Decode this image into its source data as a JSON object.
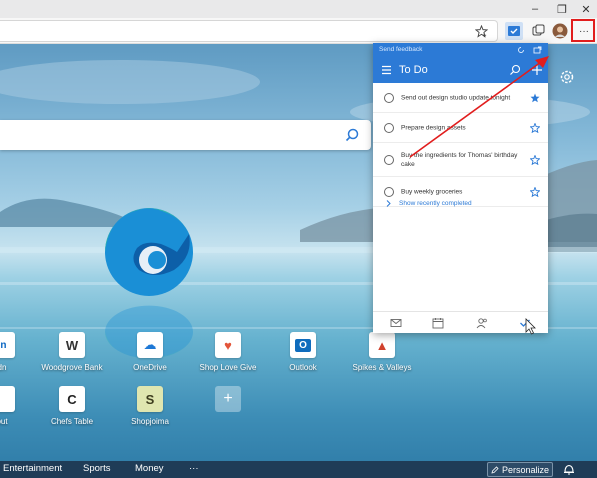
{
  "toolbar": {
    "favorite_icon": "star-add-icon",
    "todo_icon": "todo-app-icon",
    "collections_icon": "collections-icon",
    "profile_icon": "avatar",
    "more_label": "···"
  },
  "window": {
    "minimize": "–",
    "restore": "❐",
    "close": "✕"
  },
  "todo_panel": {
    "feedback_link": "Send feedback",
    "title": "To Do",
    "tasks": [
      {
        "text": "Send out design studio update tonight",
        "starred": true
      },
      {
        "text": "Prepare design assets",
        "starred": false
      },
      {
        "text": "Buy the ingredients for Thomas' birthday cake",
        "starred": false
      },
      {
        "text": "Buy weekly groceries",
        "starred": false
      }
    ],
    "show_completed": "Show recently completed"
  },
  "quick_links": [
    {
      "label": "dn",
      "glyph": "in",
      "color": "#0a66c2"
    },
    {
      "label": "Woodgrove Bank",
      "glyph": "W",
      "color": "#333333"
    },
    {
      "label": "OneDrive",
      "glyph": "☁",
      "color": "#1e78d6"
    },
    {
      "label": "Shop Love Give",
      "glyph": "♥",
      "color": "#e3553a"
    },
    {
      "label": "Outlook",
      "glyph": "O",
      "color": "#0f6cbd"
    },
    {
      "label": "Spikes & Valleys",
      "glyph": "▲",
      "color": "#d0402b"
    },
    {
      "label": "out",
      "glyph": "",
      "color": "#555555"
    },
    {
      "label": "Chefs Table",
      "glyph": "C",
      "color": "#222222"
    },
    {
      "label": "Shopjoima",
      "glyph": "S",
      "color": "#3c3c1e"
    },
    {
      "label": "",
      "glyph": "+",
      "color": "#ffffff"
    }
  ],
  "news_bar": {
    "items": [
      "Entertainment",
      "Sports",
      "Money",
      "···"
    ],
    "personalize": "Personalize"
  },
  "colors": {
    "accent": "#2c7ad6",
    "annotation_red": "#e11d1d"
  }
}
